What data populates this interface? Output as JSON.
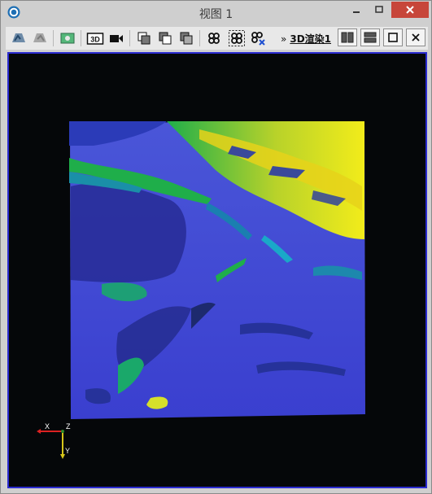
{
  "window": {
    "title": "视图 1",
    "icons": {
      "app": "app-logo-icon",
      "minimize": "minimize-icon",
      "maximize": "maximize-icon",
      "close": "close-icon"
    }
  },
  "toolbar": {
    "items": [
      "view-left-icon",
      "view-right-icon",
      "screenshot-icon",
      "3d-icon",
      "video-record-icon",
      "layer-icon-1",
      "layer-icon-2",
      "layer-icon-3",
      "network-icon-1",
      "network-icon-2",
      "network-icon-3"
    ],
    "threed_label": "3D",
    "overflow_label": "»",
    "render_label": "3D渲染1"
  },
  "axes": {
    "x_label": "X",
    "y_label": "Y",
    "z_label": "Z"
  },
  "colors": {
    "viewport_bg": "#050709",
    "viewport_border": "#2b2bd0",
    "close_button": "#c7463a",
    "terrain_base": "#3a3fcf",
    "terrain_dark": "#262a8a",
    "terrain_green": "#1fae4a",
    "terrain_yellow": "#e6e61a",
    "terrain_teal": "#1a8fa8"
  }
}
